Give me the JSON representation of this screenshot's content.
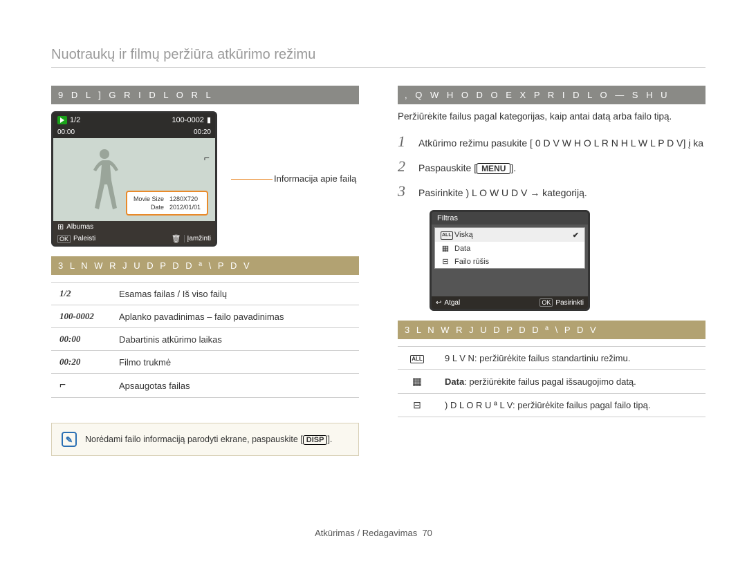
{
  "doc_title": "Nuotraukų ir filmų peržiūra atkūrimo režimu",
  "left": {
    "section_header": "9 D L ] G R   I D L O R   L",
    "device": {
      "counter": "1/2",
      "file_id": "100-0002",
      "elapsed": "00:00",
      "duration": "00:20",
      "info_row1_label": "Movie Size",
      "info_row1_value": "1280X720",
      "info_row2_label": "Date",
      "info_row2_value": "2012/01/01",
      "row_album_icon": "⊞",
      "row_album": "Albumas",
      "row_play_icon": "OK",
      "row_play": "Paleisti",
      "row_delete_icon": "🗑",
      "row_delete": "Įamžinti"
    },
    "info_label": "Informacija apie failą",
    "table_header": "3 L N W R J U D P D   D ª \\ P D V",
    "rows": [
      {
        "k": "1/2",
        "v": "Esamas failas / Iš viso failų"
      },
      {
        "k": "100-0002",
        "v": "Aplanko pavadinimas – failo pavadinimas"
      },
      {
        "k": "00:00",
        "v": "Dabartinis atkūrimo laikas"
      },
      {
        "k": "00:20",
        "v": "Filmo trukmė"
      },
      {
        "k": "⌐",
        "v": "Apsaugotas failas"
      }
    ],
    "note_prefix": "Norėdami failo informaciją parodyti ekrane, paspauskite [",
    "note_disp": "DISP",
    "note_suffix": "]."
  },
  "right": {
    "section_header": ", Q W H O    D O E X P R   I D L O —   S H U",
    "intro": "Peržiūrėkite failus pagal kategorijas, kaip antai datą arba failo tipą.",
    "steps": [
      "Atkūrimo režimu pasukite [ 0 D V W H O L R   N H L W L P D V] į ka",
      "Paspauskite [",
      "Pasirinkite  ) L O W U D V → kategoriją."
    ],
    "menu_label": "MENU",
    "step2_suffix": "].",
    "filter": {
      "head": "Filtras",
      "opts": [
        {
          "ic": "ALL",
          "label": "Viską",
          "sel": true
        },
        {
          "ic": "cal",
          "label": "Data",
          "sel": false
        },
        {
          "ic": "film",
          "label": "Failo rūšis",
          "sel": false
        }
      ],
      "foot_back_icon": "↩",
      "foot_back": "Atgal",
      "foot_ok_icon": "OK",
      "foot_ok": "Pasirinkti"
    },
    "table_header": "3 L N W R J U D P D   D ª \\ P D V",
    "rows": [
      {
        "ic": "all",
        "label_pre": "9 L V N",
        "label_rest": ": peržiūrėkite failus standartiniu režimu."
      },
      {
        "ic": "cal",
        "bold": "Data",
        "label_rest": ": peržiūrėkite failus pagal išsaugojimo datą."
      },
      {
        "ic": "film",
        "label_pre": ") D L O R   U   ª L V",
        "label_rest": ": peržiūrėkite failus pagal failo tipą."
      }
    ]
  },
  "footer_text": "Atkūrimas / Redagavimas",
  "footer_page": "70"
}
